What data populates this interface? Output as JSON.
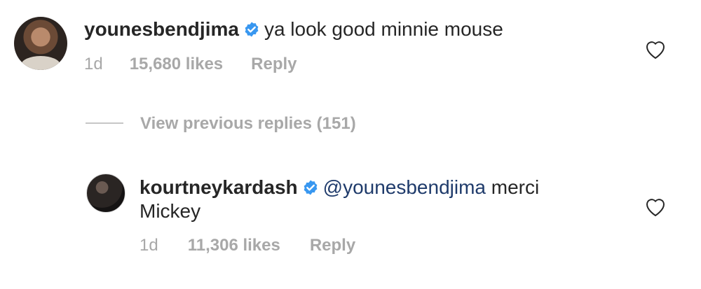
{
  "comments": [
    {
      "username": "younesbendjima",
      "text": "ya look good minnie mouse",
      "age": "1d",
      "likes": "15,680 likes",
      "reply_label": "Reply"
    }
  ],
  "view_previous": "View previous replies (151)",
  "reply": {
    "username": "kourtneykardash",
    "mention": "@younesbendjima",
    "text_line1": " merci",
    "text_line2": "Mickey",
    "age": "1d",
    "likes": "11,306 likes",
    "reply_label": "Reply"
  },
  "colors": {
    "text": "#262626",
    "muted": "#a8a8a8",
    "verified": "#3897f0",
    "mention": "#1f3b6b"
  },
  "icons": [
    "verified-badge-icon",
    "heart-outline-icon"
  ]
}
